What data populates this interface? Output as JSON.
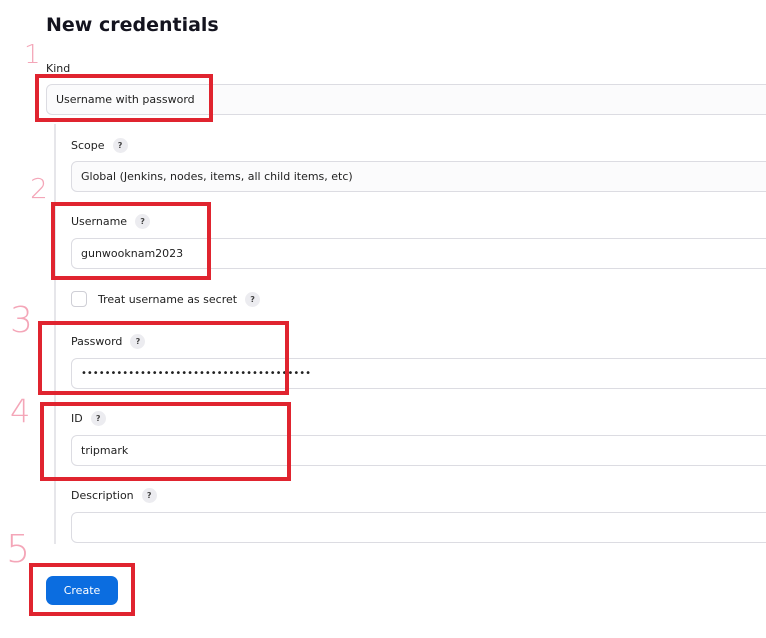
{
  "page_title": "New credentials",
  "kind": {
    "label": "Kind",
    "value": "Username with password"
  },
  "scope": {
    "label": "Scope",
    "value": "Global (Jenkins, nodes, items, all child items, etc)"
  },
  "username": {
    "label": "Username",
    "value": "gunwooknam2023"
  },
  "treat_secret": {
    "label": "Treat username as secret",
    "checked": false
  },
  "password": {
    "label": "Password",
    "value": "•••••••••••••••••••••••••••••••••••••••"
  },
  "id": {
    "label": "ID",
    "value": "tripmark"
  },
  "description": {
    "label": "Description",
    "value": ""
  },
  "help_icon_text": "?",
  "create_button": "Create",
  "annotations": {
    "numbers": [
      "1",
      "2",
      "3",
      "4",
      "5"
    ],
    "highlight_color": "#e0242f",
    "number_color": "#f4a6b8"
  }
}
